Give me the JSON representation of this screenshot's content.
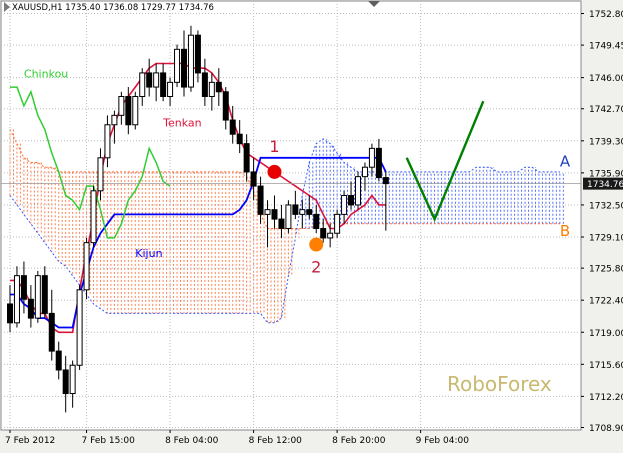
{
  "header": {
    "symbol_text": "XAUUSD,H1  1735.40 1736.08 1729.77 1734.76"
  },
  "watermark": "RoboForex",
  "colors": {
    "background": "#ffffff",
    "grid": "#bdbdbd",
    "candle_bull": "#ffffff",
    "candle_bear": "#000000",
    "tenkan": "#dc143c",
    "kijun": "#0000ff",
    "chinkou": "#32cd32",
    "kumo_up": "#ff6a33",
    "kumo_down": "#3355ff",
    "forecast": "#008000",
    "marker1": "#e60000",
    "marker2": "#ff7f00",
    "label_a": "#1f3fbf",
    "label_b": "#ff7f00",
    "price_box": "#1a1a1a",
    "watermark": "#c8b970"
  },
  "chart_data": {
    "type": "candlestick",
    "title": "XAUUSD,H1",
    "ohlc_header": [
      1735.4,
      1736.08,
      1729.77,
      1734.76
    ],
    "ylim": [
      1708.9,
      1753.9
    ],
    "y_ticks": [
      "1752.80",
      "1749.45",
      "1746.00",
      "1742.70",
      "1739.30",
      "1735.90",
      "1732.50",
      "1729.10",
      "1725.80",
      "1722.40",
      "1719.00",
      "1715.60",
      "1712.20",
      "1708.90"
    ],
    "x_ticks": [
      {
        "bar": 0,
        "label": "7 Feb 2012"
      },
      {
        "bar": 11,
        "label": "7 Feb 15:00"
      },
      {
        "bar": 23,
        "label": "8 Feb 04:00"
      },
      {
        "bar": 35,
        "label": "8 Feb 12:00"
      },
      {
        "bar": 47,
        "label": "8 Feb 20:00"
      },
      {
        "bar": 59,
        "label": "9 Feb 04:00"
      }
    ],
    "current_price": "1734.76",
    "candles": [
      [
        1722.0,
        1724.0,
        1719.0,
        1720.0
      ],
      [
        1720.0,
        1726.0,
        1719.5,
        1725.0
      ],
      [
        1725.0,
        1726.5,
        1721.0,
        1722.5
      ],
      [
        1722.5,
        1724.0,
        1719.5,
        1720.5
      ],
      [
        1720.5,
        1725.5,
        1720.0,
        1725.0
      ],
      [
        1725.0,
        1726.0,
        1720.5,
        1721.0
      ],
      [
        1721.0,
        1723.5,
        1716.0,
        1717.0
      ],
      [
        1717.0,
        1718.0,
        1714.0,
        1715.0
      ],
      [
        1715.0,
        1716.5,
        1710.5,
        1712.5
      ],
      [
        1712.5,
        1716.0,
        1711.0,
        1715.5
      ],
      [
        1715.5,
        1724.0,
        1715.0,
        1723.5
      ],
      [
        1723.5,
        1729.0,
        1722.5,
        1728.5
      ],
      [
        1728.5,
        1734.5,
        1728.0,
        1734.0
      ],
      [
        1734.0,
        1738.5,
        1733.0,
        1737.5
      ],
      [
        1737.5,
        1742.0,
        1736.5,
        1741.0
      ],
      [
        1741.0,
        1742.5,
        1739.0,
        1742.0
      ],
      [
        1742.0,
        1744.5,
        1741.0,
        1744.0
      ],
      [
        1744.0,
        1745.0,
        1740.0,
        1741.0
      ],
      [
        1741.0,
        1744.5,
        1740.5,
        1744.0
      ],
      [
        1744.0,
        1747.0,
        1743.0,
        1746.5
      ],
      [
        1746.5,
        1748.0,
        1744.0,
        1745.0
      ],
      [
        1745.0,
        1747.5,
        1743.5,
        1746.5
      ],
      [
        1746.5,
        1747.5,
        1743.5,
        1744.0
      ],
      [
        1744.0,
        1746.0,
        1743.0,
        1745.5
      ],
      [
        1745.5,
        1749.5,
        1745.0,
        1749.0
      ],
      [
        1749.0,
        1751.0,
        1744.0,
        1745.0
      ],
      [
        1745.0,
        1751.5,
        1744.5,
        1750.5
      ],
      [
        1750.5,
        1751.0,
        1745.5,
        1746.5
      ],
      [
        1746.5,
        1748.0,
        1743.0,
        1744.0
      ],
      [
        1744.0,
        1746.5,
        1742.5,
        1745.5
      ],
      [
        1745.5,
        1747.0,
        1743.0,
        1744.5
      ],
      [
        1744.5,
        1745.0,
        1740.5,
        1741.5
      ],
      [
        1741.5,
        1743.0,
        1739.0,
        1740.0
      ],
      [
        1740.0,
        1741.5,
        1738.0,
        1739.0
      ],
      [
        1739.0,
        1740.0,
        1735.0,
        1736.0
      ],
      [
        1736.0,
        1737.5,
        1733.0,
        1734.5
      ],
      [
        1734.5,
        1735.5,
        1730.5,
        1731.5
      ],
      [
        1731.5,
        1733.0,
        1728.0,
        1732.0
      ],
      [
        1732.0,
        1733.5,
        1730.0,
        1731.0
      ],
      [
        1731.0,
        1732.5,
        1729.0,
        1730.0
      ],
      [
        1730.0,
        1733.0,
        1729.5,
        1732.5
      ],
      [
        1732.5,
        1734.0,
        1731.0,
        1731.5
      ],
      [
        1731.5,
        1733.0,
        1730.0,
        1732.0
      ],
      [
        1732.0,
        1733.5,
        1731.0,
        1731.5
      ],
      [
        1731.5,
        1732.5,
        1729.5,
        1730.0
      ],
      [
        1730.0,
        1731.0,
        1728.5,
        1729.0
      ],
      [
        1729.0,
        1730.5,
        1728.0,
        1729.5
      ],
      [
        1729.5,
        1732.0,
        1729.0,
        1731.5
      ],
      [
        1731.5,
        1734.0,
        1730.5,
        1733.5
      ],
      [
        1733.5,
        1735.0,
        1732.0,
        1732.5
      ],
      [
        1732.5,
        1736.0,
        1732.0,
        1735.5
      ],
      [
        1735.5,
        1737.0,
        1734.0,
        1736.5
      ],
      [
        1736.5,
        1739.0,
        1735.5,
        1738.5
      ],
      [
        1738.5,
        1739.5,
        1735.0,
        1735.4
      ],
      [
        1735.4,
        1736.08,
        1729.77,
        1734.76
      ]
    ],
    "tenkan": [
      1724.5,
      1724.5,
      1723.5,
      1722.0,
      1721.0,
      1721.0,
      1719.5,
      1719.0,
      1719.0,
      1719.0,
      1723.5,
      1727.5,
      1731.0,
      1735.5,
      1739.0,
      1741.0,
      1743.0,
      1744.0,
      1745.0,
      1746.0,
      1747.0,
      1747.5,
      1747.5,
      1747.5,
      1747.5,
      1747.5,
      1747.0,
      1747.0,
      1747.0,
      1746.5,
      1745.5,
      1744.0,
      1741.5,
      1739.5,
      1738.0,
      1737.5,
      1737.0,
      1736.5,
      1736.0,
      1735.5,
      1735.0,
      1734.5,
      1734.0,
      1733.5,
      1733.0,
      1731.5,
      1730.0,
      1730.0,
      1730.5,
      1731.5,
      1732.0,
      1732.5,
      1733.5,
      1732.5,
      1732.5
    ],
    "kijun": [
      1723.0,
      1723.0,
      1722.0,
      1721.5,
      1720.5,
      1720.5,
      1720.0,
      1719.5,
      1719.5,
      1719.5,
      1723.0,
      1725.5,
      1728.0,
      1729.5,
      1730.5,
      1731.5,
      1731.5,
      1731.5,
      1731.5,
      1731.5,
      1731.5,
      1731.5,
      1731.5,
      1731.5,
      1731.5,
      1731.5,
      1731.5,
      1731.5,
      1731.5,
      1731.5,
      1731.5,
      1731.5,
      1731.5,
      1732.0,
      1733.0,
      1735.0,
      1737.5,
      1737.5,
      1737.5,
      1737.5,
      1737.5,
      1737.5,
      1737.5,
      1737.5,
      1737.5,
      1737.5,
      1737.5,
      1737.5,
      1737.5,
      1737.5,
      1737.5,
      1737.5,
      1737.5,
      1737.5,
      1736.0
    ],
    "chinkou": [
      1745.0,
      1745.0,
      1743.0,
      1744.5,
      1742.0,
      1740.5,
      1738.0,
      1736.0,
      1733.5,
      1733.0,
      1732.0,
      1734.5,
      1734.5,
      1732.0,
      1729.0,
      1729.0,
      1730.5,
      1733.0,
      1734.0,
      1735.5,
      1738.5,
      1737.0,
      1735.0,
      1734.5
    ],
    "span_a": [
      1740.5,
      1739.0,
      1737.5,
      1737.0,
      1737.0,
      1736.5,
      1736.5,
      1736.0,
      1736.0,
      1736.0,
      1736.0,
      1736.0,
      1736.0,
      1736.0,
      1736.0,
      1736.0,
      1736.0,
      1736.0,
      1736.0,
      1736.0,
      1736.0,
      1736.0,
      1736.0,
      1736.0,
      1736.0,
      1736.0,
      1736.0,
      1736.0,
      1736.0,
      1736.0,
      1736.0,
      1736.0,
      1736.0,
      1736.0,
      1735.5,
      1734.0,
      1731.5,
      1730.0,
      1730.0,
      1730.0,
      1730.0,
      1730.0,
      1730.0,
      1730.0,
      1730.5,
      1730.5,
      1730.5,
      1730.5,
      1730.5,
      1730.5,
      1730.5,
      1730.5,
      1730.5,
      1730.5,
      1730.5,
      1730.5,
      1730.5,
      1730.5,
      1730.5,
      1730.5,
      1730.5,
      1730.5,
      1730.5,
      1730.5,
      1730.5,
      1730.5,
      1730.5,
      1730.5,
      1730.5,
      1730.5,
      1730.5,
      1730.5,
      1730.5,
      1730.5,
      1730.5,
      1730.5,
      1730.5,
      1730.5,
      1730.5,
      1730.5
    ],
    "span_b": [
      1733.5,
      1732.5,
      1731.5,
      1730.5,
      1729.5,
      1728.5,
      1727.5,
      1726.5,
      1726.0,
      1725.0,
      1724.0,
      1723.0,
      1722.0,
      1721.5,
      1721.0,
      1721.0,
      1721.0,
      1721.0,
      1721.0,
      1721.0,
      1721.0,
      1721.0,
      1721.0,
      1721.0,
      1721.0,
      1721.0,
      1721.0,
      1721.0,
      1721.0,
      1721.0,
      1721.0,
      1721.0,
      1721.0,
      1721.0,
      1721.0,
      1721.0,
      1721.0,
      1720.0,
      1720.0,
      1720.5,
      1725.0,
      1729.0,
      1733.5,
      1737.0,
      1739.0,
      1739.5,
      1739.0,
      1738.0,
      1737.0,
      1736.5,
      1736.0,
      1736.0,
      1736.0,
      1736.0,
      1736.0,
      1736.0,
      1736.0,
      1736.0,
      1736.0,
      1736.0,
      1736.0,
      1736.0,
      1736.0,
      1736.0,
      1736.0,
      1736.0,
      1736.0,
      1736.5,
      1736.5,
      1736.5,
      1736.0,
      1736.0,
      1736.0,
      1736.0,
      1736.5,
      1736.5,
      1736.0,
      1736.0,
      1736.0,
      1736.0
    ],
    "forecast": [
      {
        "bar": 57,
        "y": 1737.5
      },
      {
        "bar": 61,
        "y": 1731.0
      },
      {
        "bar": 68,
        "y": 1743.5
      }
    ],
    "markers": [
      {
        "label": "1",
        "bar": 38,
        "y": 1736.0
      },
      {
        "label": "2",
        "bar": 44,
        "y": 1728.3
      }
    ],
    "annotations": [
      {
        "text": "Chinkou",
        "bar": 2,
        "y": 1746.0
      },
      {
        "text": "Tenkan",
        "bar": 22,
        "y": 1740.8
      },
      {
        "text": "Kijun",
        "bar": 18,
        "y": 1727.0
      },
      {
        "text": "A",
        "bar": 79,
        "y": 1736.6
      },
      {
        "text": "B",
        "bar": 79,
        "y": 1729.2
      }
    ]
  }
}
